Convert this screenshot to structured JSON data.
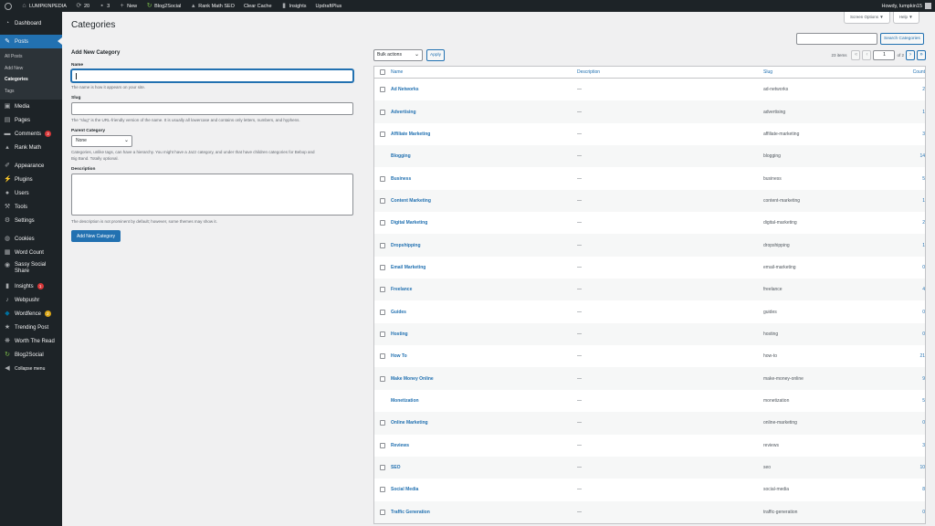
{
  "admin_bar": {
    "site_name": "LUMPKINPEDIA",
    "updates_count": "20",
    "comments_count": "3",
    "new_label": "New",
    "items": [
      "Blog2Social",
      "Rank Math SEO",
      "Clear Cache",
      "Insights",
      "UpdraftPlus"
    ],
    "greeting": "Howdy, lumpkin15"
  },
  "sidebar": {
    "dashboard": "Dashboard",
    "posts": "Posts",
    "posts_sub": [
      "All Posts",
      "Add New",
      "Categories",
      "Tags"
    ],
    "media": "Media",
    "pages": "Pages",
    "comments": "Comments",
    "comments_badge": "3",
    "rank_math": "Rank Math",
    "appearance": "Appearance",
    "plugins": "Plugins",
    "users": "Users",
    "tools": "Tools",
    "settings": "Settings",
    "cookies": "Cookies",
    "word_count": "Word Count",
    "sassy_social_1": "Sassy Social",
    "sassy_social_2": "Share",
    "insights": "Insights",
    "insights_badge": "1",
    "webpushr": "Webpushr",
    "wordfence": "Wordfence",
    "wordfence_badge": "2",
    "trending_post": "Trending Post",
    "worth_the_read": "Worth The Read",
    "blog2social": "Blog2Social",
    "collapse": "Collapse menu"
  },
  "screen_meta": {
    "screen_options": "Screen Options ▼",
    "help": "Help ▼"
  },
  "page": {
    "title": "Categories"
  },
  "form": {
    "heading": "Add New Category",
    "name_label": "Name",
    "name_help": "The name is how it appears on your site.",
    "slug_label": "Slug",
    "slug_help": "The “slug” is the URL-friendly version of the name. It is usually all lowercase and contains only letters, numbers, and hyphens.",
    "parent_label": "Parent Category",
    "parent_value": "None",
    "parent_help_1": "Categories, unlike tags, can have a hierarchy. You might have a Jazz category, and under that have children categories for Bebop and",
    "parent_help_2": "Big Band. Totally optional.",
    "desc_label": "Description",
    "desc_help": "The description is not prominent by default; however, some themes may show it.",
    "submit": "Add New Category"
  },
  "list": {
    "search_button": "Search Categories",
    "bulk_actions": "Bulk actions",
    "apply": "Apply",
    "items_count": "23 items",
    "current_page": "1",
    "of_pages": "of 2",
    "columns": {
      "name": "Name",
      "description": "Description",
      "slug": "Slug",
      "count": "Count"
    },
    "rows": [
      {
        "name": "Ad Networks",
        "desc": "—",
        "slug": "ad-networks",
        "count": "2",
        "cb": true
      },
      {
        "name": "Advertising",
        "desc": "—",
        "slug": "advertising",
        "count": "1",
        "cb": true
      },
      {
        "name": "Affiliate Marketing",
        "desc": "—",
        "slug": "affiliate-marketing",
        "count": "3",
        "cb": true
      },
      {
        "name": "Blogging",
        "desc": "—",
        "slug": "blogging",
        "count": "14",
        "cb": false
      },
      {
        "name": "Business",
        "desc": "—",
        "slug": "business",
        "count": "5",
        "cb": true
      },
      {
        "name": "Content Marketing",
        "desc": "—",
        "slug": "content-marketing",
        "count": "1",
        "cb": true
      },
      {
        "name": "Digital Marketing",
        "desc": "—",
        "slug": "digital-marketing",
        "count": "2",
        "cb": true
      },
      {
        "name": "Dropshipping",
        "desc": "—",
        "slug": "dropshipping",
        "count": "1",
        "cb": true
      },
      {
        "name": "Email Marketing",
        "desc": "—",
        "slug": "email-marketing",
        "count": "0",
        "cb": true
      },
      {
        "name": "Freelance",
        "desc": "—",
        "slug": "freelance",
        "count": "4",
        "cb": true
      },
      {
        "name": "Guides",
        "desc": "—",
        "slug": "guides",
        "count": "0",
        "cb": true
      },
      {
        "name": "Hosting",
        "desc": "—",
        "slug": "hosting",
        "count": "0",
        "cb": true
      },
      {
        "name": "How To",
        "desc": "—",
        "slug": "how-to",
        "count": "21",
        "cb": true
      },
      {
        "name": "Make Money Online",
        "desc": "—",
        "slug": "make-money-online",
        "count": "9",
        "cb": true
      },
      {
        "name": "Monetization",
        "desc": "—",
        "slug": "monetization",
        "count": "5",
        "cb": false
      },
      {
        "name": "Online Marketing",
        "desc": "—",
        "slug": "online-marketing",
        "count": "0",
        "cb": true
      },
      {
        "name": "Reviews",
        "desc": "—",
        "slug": "reviews",
        "count": "3",
        "cb": true
      },
      {
        "name": "SEO",
        "desc": "—",
        "slug": "seo",
        "count": "10",
        "cb": true
      },
      {
        "name": "Social Media",
        "desc": "—",
        "slug": "social-media",
        "count": "8",
        "cb": true
      },
      {
        "name": "Traffic Generation",
        "desc": "—",
        "slug": "traffic-generation",
        "count": "0",
        "cb": true
      }
    ]
  }
}
